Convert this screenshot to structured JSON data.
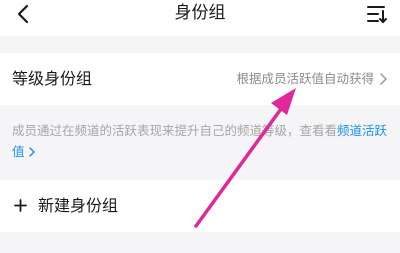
{
  "header": {
    "title": "身份组",
    "back_icon": "chevron-left-icon",
    "sort_icon": "sort-icon"
  },
  "level_row": {
    "label": "等级身份组",
    "value": "根据成员活跃值自动获得",
    "chevron_icon": "chevron-right-icon"
  },
  "description": {
    "text": "成员通过在频道的活跃表现来提升自己的频道等级，查看看",
    "link_text": "频道活跃值"
  },
  "new_role_row": {
    "plus_icon": "plus-icon",
    "label": "新建身份组"
  },
  "colors": {
    "link": "#1e90e8",
    "annotation_arrow": "#e0289a",
    "page_background": "#f5f5f7"
  }
}
